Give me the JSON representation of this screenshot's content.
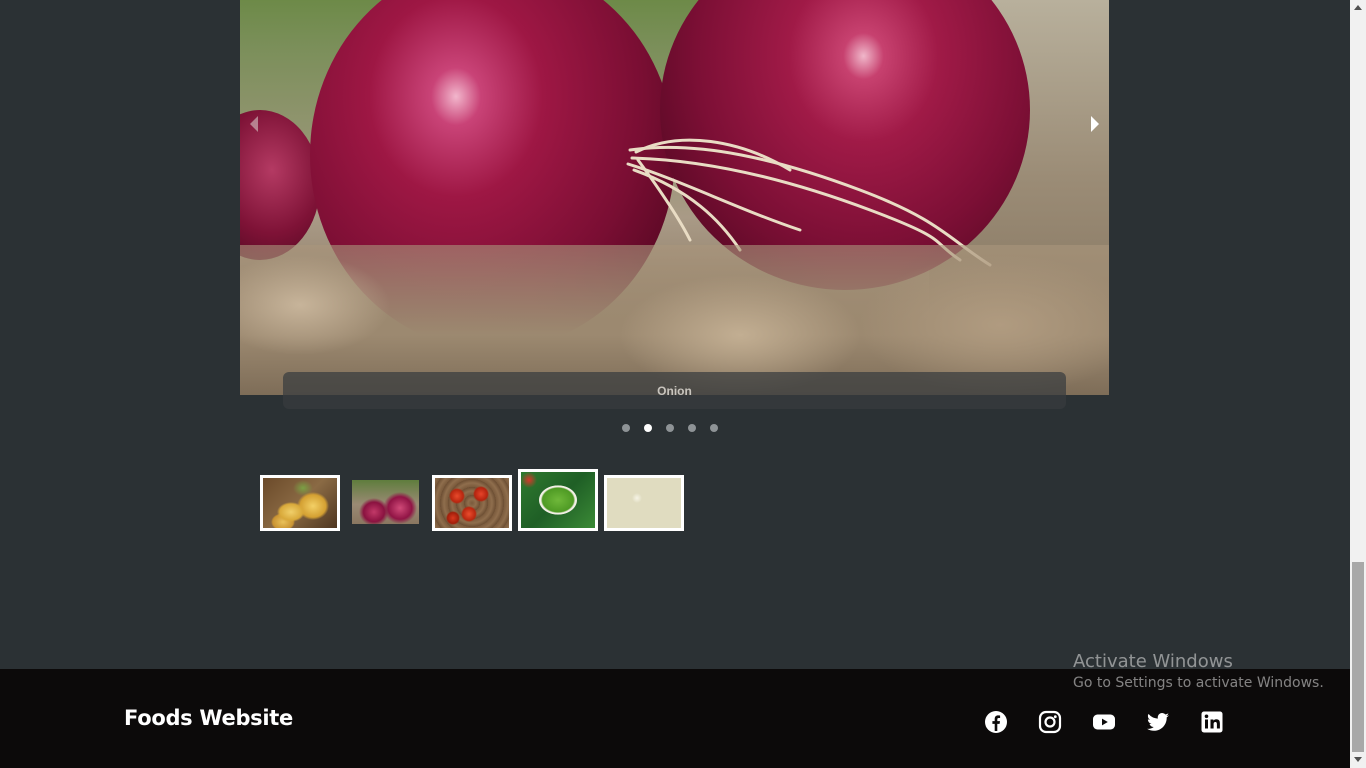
{
  "slider": {
    "caption": "Onion",
    "current_index": 1,
    "slide_count": 5,
    "prev_icon": "chevron-left-icon",
    "next_icon": "chevron-right-icon"
  },
  "thumbnails": [
    {
      "name": "potato"
    },
    {
      "name": "onion"
    },
    {
      "name": "tomato"
    },
    {
      "name": "green-chilli"
    },
    {
      "name": "cauliflower"
    }
  ],
  "footer": {
    "brand": "Foods Website",
    "social_icons": [
      "facebook-icon",
      "instagram-icon",
      "youtube-icon",
      "twitter-icon",
      "linkedin-icon"
    ]
  },
  "watermark": {
    "title": "Activate Windows",
    "subtitle": "Go to Settings to activate Windows."
  },
  "colors": {
    "page_bg": "#2b3134",
    "footer_bg": "#0c0a0a",
    "dot_active": "#ffffff",
    "dot_inactive": "#8e9396"
  }
}
